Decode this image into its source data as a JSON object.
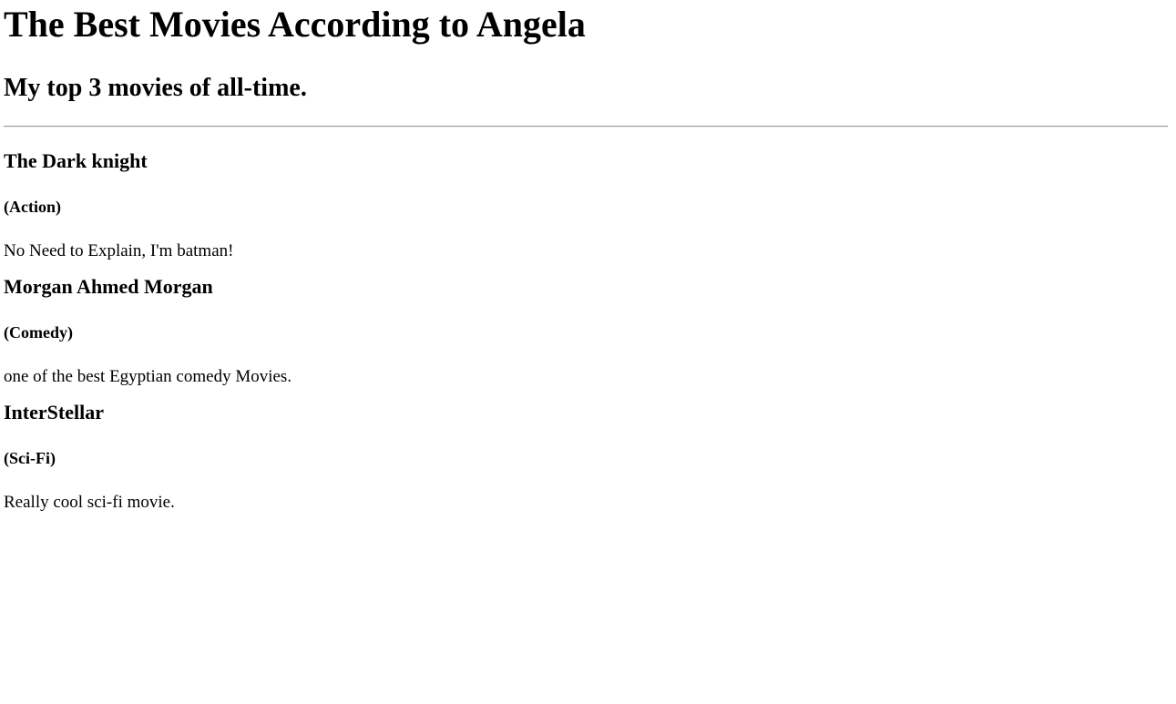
{
  "page": {
    "title": "The Best Movies According to Angela",
    "subtitle": "My top 3 movies of all-time."
  },
  "movies": [
    {
      "name": "The Dark knight",
      "genre": "(Action)",
      "description": "No Need to Explain, I'm batman!"
    },
    {
      "name": "Morgan Ahmed Morgan",
      "genre": "(Comedy)",
      "description": "one of the best Egyptian comedy Movies."
    },
    {
      "name": "InterStellar",
      "genre": "(Sci-Fi)",
      "description": "Really cool sci-fi movie."
    }
  ]
}
